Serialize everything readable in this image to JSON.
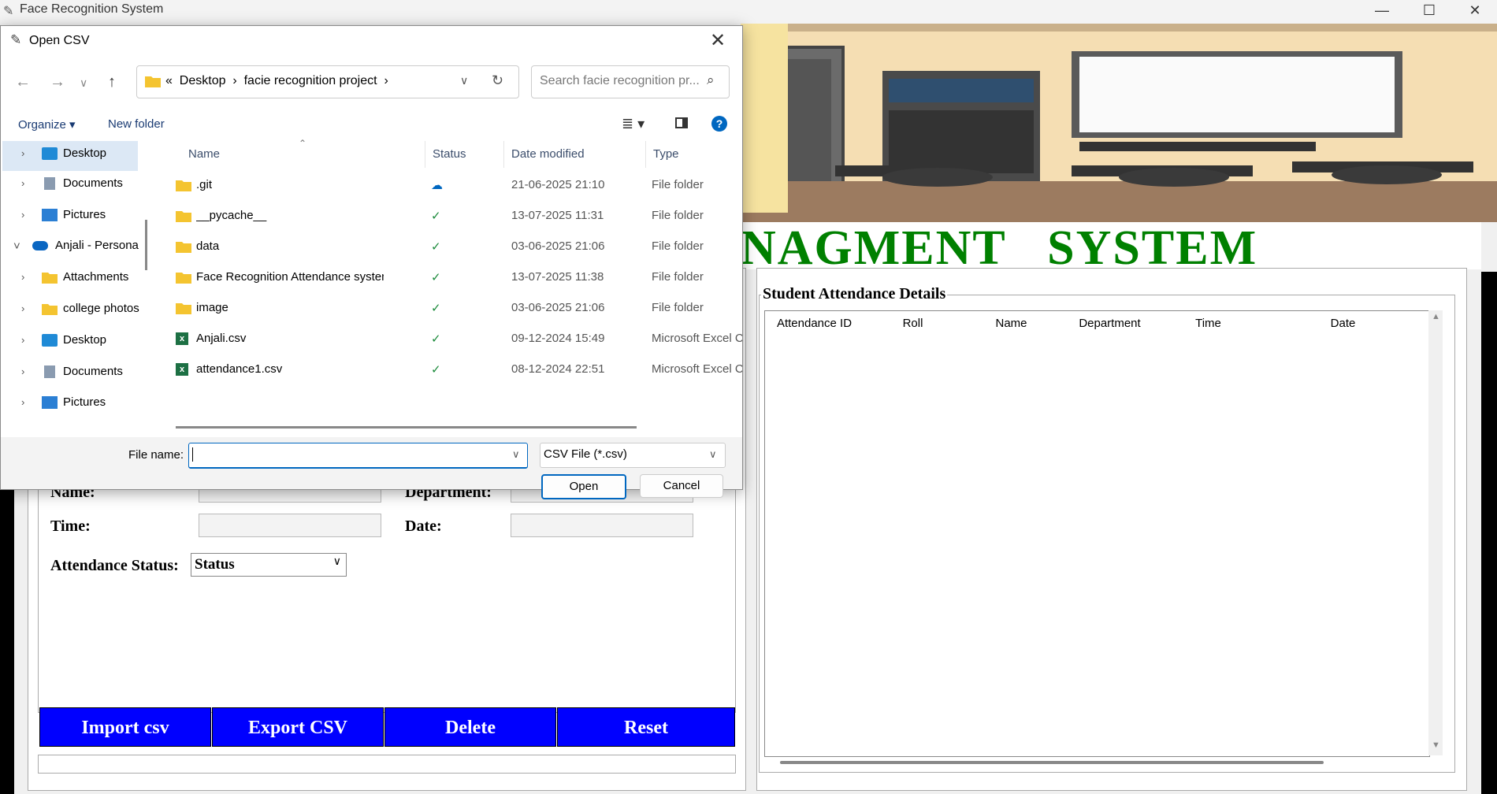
{
  "main": {
    "title": "Face Recognition System",
    "heading": "NAGMENT   SYSTEM",
    "form": {
      "name_label": "Name:",
      "department_label": "Department:",
      "time_label": "Time:",
      "date_label": "Date:",
      "attendance_status_label": "Attendance Status:",
      "status_value": "Status"
    },
    "buttons": {
      "import": "Import csv",
      "export": "Export CSV",
      "delete": "Delete",
      "reset": "Reset"
    },
    "details": {
      "title": "Student  Attendance Details",
      "columns": [
        "Attendance ID",
        "Roll",
        "Name",
        "Department",
        "Time",
        "Date"
      ]
    }
  },
  "dialog": {
    "title": "Open CSV",
    "breadcrumb": "«  Desktop  ›  facie recognition project  ›",
    "search_placeholder": "Search facie recognition pr...",
    "organize": "Organize ▾",
    "new_folder": "New folder",
    "nav": [
      {
        "label": "Desktop",
        "icon": "desktop-icon",
        "chev": "›"
      },
      {
        "label": "Documents",
        "icon": "documents-icon",
        "chev": "›"
      },
      {
        "label": "Pictures",
        "icon": "pictures-icon",
        "chev": "›"
      },
      {
        "label": "Anjali - Persona",
        "icon": "onedrive-cloud-icon",
        "chev": "˅"
      },
      {
        "label": "Attachments",
        "icon": "folder-icon",
        "chev": "›"
      },
      {
        "label": "college photos",
        "icon": "folder-icon",
        "chev": "›"
      },
      {
        "label": "Desktop",
        "icon": "desktop-icon",
        "chev": "›"
      },
      {
        "label": "Documents",
        "icon": "documents-icon",
        "chev": "›"
      },
      {
        "label": "Pictures",
        "icon": "pictures-icon",
        "chev": "›"
      }
    ],
    "columns": {
      "name": "Name",
      "status": "Status",
      "date": "Date modified",
      "type": "Type"
    },
    "files": [
      {
        "name": ".git",
        "status": "cloud",
        "date": "21-06-2025 21:10",
        "type": "File folder",
        "icon": "folder-icon"
      },
      {
        "name": "__pycache__",
        "status": "synced",
        "date": "13-07-2025 11:31",
        "type": "File folder",
        "icon": "folder-icon"
      },
      {
        "name": "data",
        "status": "synced",
        "date": "03-06-2025 21:06",
        "type": "File folder",
        "icon": "folder-icon"
      },
      {
        "name": "Face Recognition Attendance system Pro...",
        "status": "synced",
        "date": "13-07-2025 11:38",
        "type": "File folder",
        "icon": "folder-icon"
      },
      {
        "name": "image",
        "status": "synced",
        "date": "03-06-2025 21:06",
        "type": "File folder",
        "icon": "folder-icon"
      },
      {
        "name": "Anjali.csv",
        "status": "synced",
        "date": "09-12-2024 15:49",
        "type": "Microsoft Excel C",
        "icon": "excel-file-icon"
      },
      {
        "name": "attendance1.csv",
        "status": "synced",
        "date": "08-12-2024 22:51",
        "type": "Microsoft Excel C",
        "icon": "excel-file-icon"
      }
    ],
    "file_name_label": "File name:",
    "file_name_value": "",
    "file_type": "CSV File (*.csv)",
    "open": "Open",
    "cancel": "Cancel"
  },
  "colors": {
    "heading_green": "#008000",
    "button_blue": "#0000ff",
    "accent": "#0067c0"
  }
}
